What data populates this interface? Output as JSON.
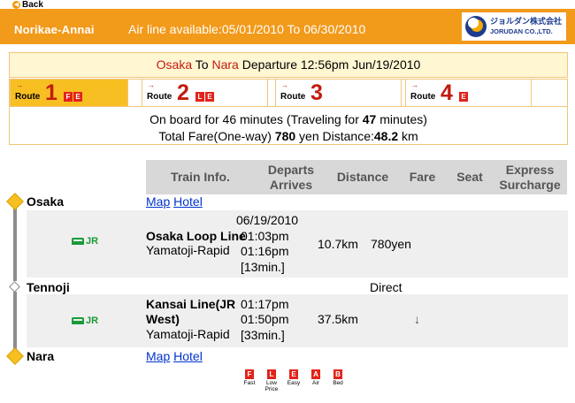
{
  "header": {
    "back_label": "Back",
    "brand": "Norikae-Annai",
    "airline_notice": "Air line available:05/01/2010 To 06/30/2010",
    "logo": {
      "jp": "ジョルダン株式会社",
      "en": "JORUDAN CO.,LTD."
    }
  },
  "search": {
    "origin": "Osaka",
    "to_word": "To",
    "destination": "Nara",
    "departure_text": "Departure 12:56pm Jun/19/2010"
  },
  "routes": [
    {
      "label": "Route",
      "number": "1",
      "badges": [
        "F",
        "E"
      ],
      "active": true
    },
    {
      "label": "Route",
      "number": "2",
      "badges": [
        "L",
        "E"
      ],
      "active": false
    },
    {
      "label": "Route",
      "number": "3",
      "badges": [],
      "active": false
    },
    {
      "label": "Route",
      "number": "4",
      "badges": [
        "E"
      ],
      "active": false
    }
  ],
  "summary": {
    "onboard_prefix": "On board for 46 minutes (Traveling for ",
    "traveling_minutes": "47",
    "onboard_suffix": " minutes)",
    "fare_prefix": "Total Fare(One-way) ",
    "fare_value": "780",
    "fare_mid": " yen Distance:",
    "distance_value": "48.2",
    "distance_unit": " km"
  },
  "table": {
    "headers": {
      "train_info": "Train Info.",
      "departs": "Departs",
      "arrives": "Arrives",
      "distance": "Distance",
      "fare": "Fare",
      "seat": "Seat",
      "express": "Express",
      "surcharge": "Surcharge"
    },
    "stations": [
      {
        "name": "Osaka",
        "map": "Map",
        "hotel": "Hotel"
      },
      {
        "name": "Tennoji",
        "transfer_note": "Direct"
      },
      {
        "name": "Nara",
        "map": "Map",
        "hotel": "Hotel"
      }
    ],
    "legs": [
      {
        "operator": "JR",
        "date": "06/19/2010",
        "line": "Osaka Loop Line",
        "service": "Yamatoji-Rapid",
        "departs": "01:03pm",
        "arrives": "01:16pm",
        "duration": "[13min.]",
        "distance": "10.7km",
        "fare": "780yen"
      },
      {
        "operator": "JR",
        "line_1": "Kansai Line(JR",
        "line_2": "West)",
        "service": "Yamatoji-Rapid",
        "departs": "01:17pm",
        "arrives": "01:50pm",
        "duration": "[33min.]",
        "distance": "37.5km",
        "fare": "↓"
      }
    ]
  },
  "legend": [
    {
      "badge": "F",
      "text": "Fast"
    },
    {
      "badge": "L",
      "text": "Low Price"
    },
    {
      "badge": "E",
      "text": "Easy"
    },
    {
      "badge": "A",
      "text": "Air"
    },
    {
      "badge": "B",
      "text": "Bed"
    }
  ],
  "colors": {
    "brand_orange": "#f29a1a",
    "active_tab": "#f7bf22",
    "badge_red": "#e2231a",
    "city_red": "#c21b0e",
    "jr_green": "#1a9b3a",
    "link_blue": "#0033cc"
  }
}
